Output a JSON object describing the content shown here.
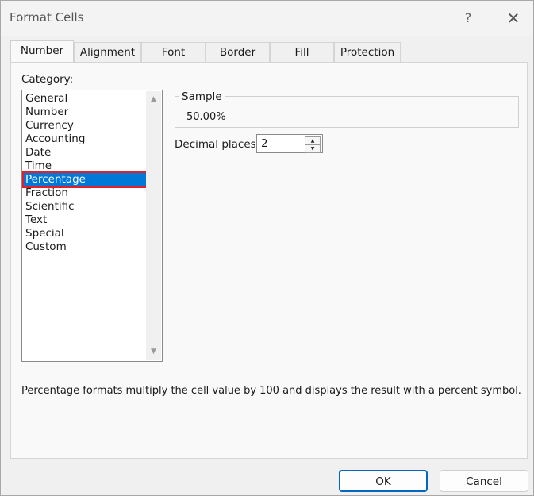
{
  "window": {
    "title": "Format Cells",
    "help_label": "?",
    "close_label": "✕"
  },
  "tabs": [
    {
      "label": "Number",
      "active": true
    },
    {
      "label": "Alignment"
    },
    {
      "label": "Font"
    },
    {
      "label": "Border"
    },
    {
      "label": "Fill"
    },
    {
      "label": "Protection"
    }
  ],
  "category": {
    "label": "Category:",
    "items": [
      "General",
      "Number",
      "Currency",
      "Accounting",
      "Date",
      "Time",
      "Percentage",
      "Fraction",
      "Scientific",
      "Text",
      "Special",
      "Custom"
    ],
    "selected": "Percentage"
  },
  "sample": {
    "legend": "Sample",
    "value": "50.00%"
  },
  "decimal_places": {
    "label": "Decimal places:",
    "value": "2"
  },
  "description": "Percentage formats multiply the cell value by 100 and displays the result with a percent symbol.",
  "buttons": {
    "ok": "OK",
    "cancel": "Cancel"
  },
  "colors": {
    "selection": "#0078d7",
    "highlight_outline": "#e0202a",
    "ok_border": "#0067c0"
  }
}
